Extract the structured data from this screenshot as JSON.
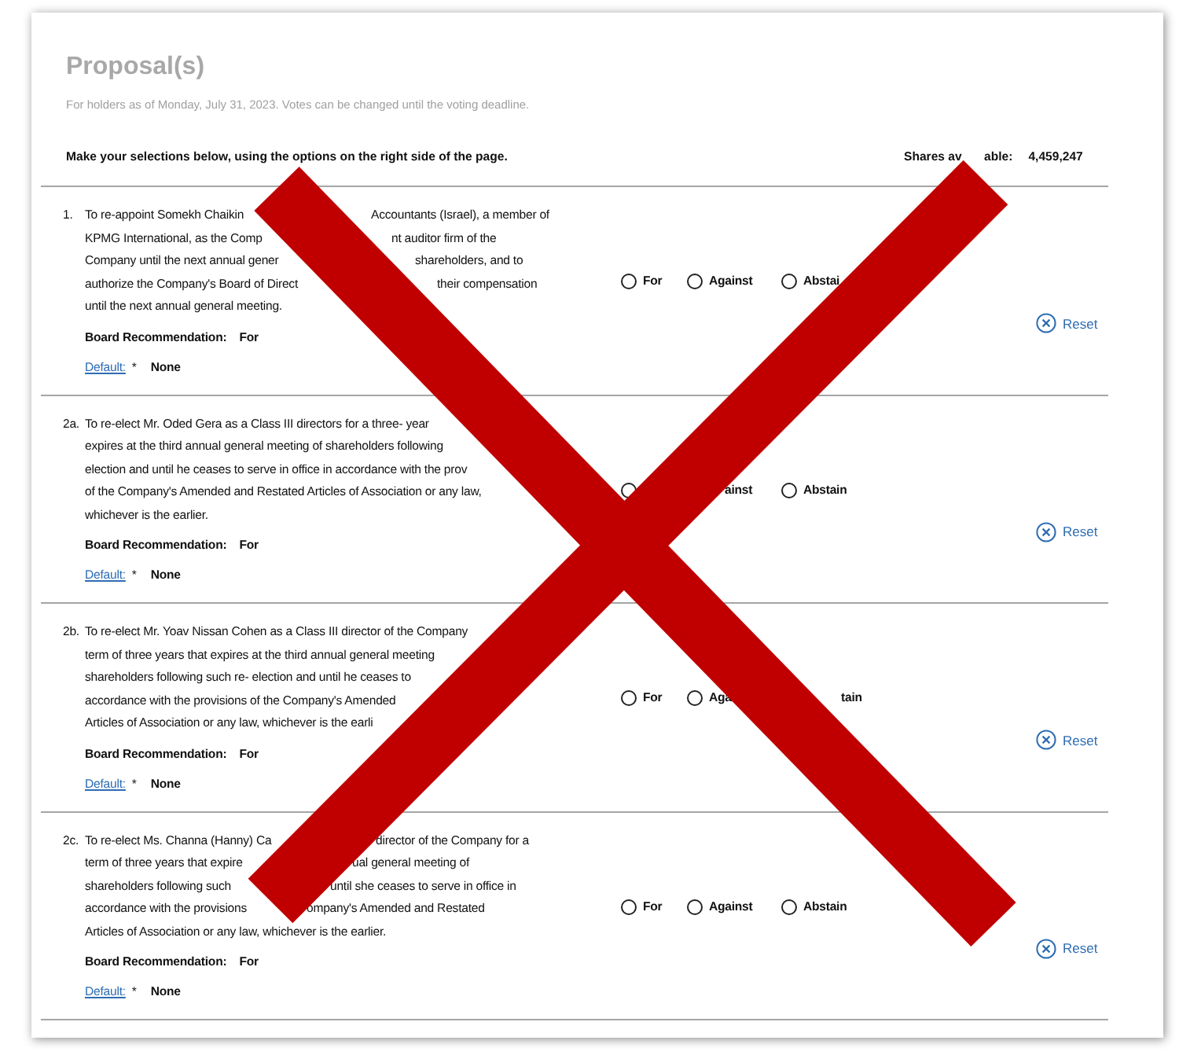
{
  "header": {
    "title": "Proposal(s)",
    "subtitle": "For holders as of Monday, July 31, 2023. Votes can be changed until the voting deadline.",
    "instructions": "Make your selections below, using the options on the right side of the page.",
    "shares_label": [
      "Shares av",
      "able:"
    ],
    "shares_value": "4,459,247"
  },
  "proposals": [
    {
      "number": "1.",
      "lines": [
        [
          "To re-appoint Somekh Chaikin",
          "Accountants (Israel), a member of"
        ],
        [
          "KPMG International, as the Comp",
          "nt auditor firm of the"
        ],
        [
          "Company until the next annual gener",
          "shareholders, and to"
        ],
        [
          "authorize the Company's Board of Direct",
          "their compensation"
        ],
        [
          "until the next annual general meeting."
        ]
      ],
      "recommendation_label": "Board Recommendation:",
      "recommendation": "For",
      "default_link": "Default:",
      "default_mark": "*",
      "default_value": "None",
      "options": [
        {
          "label": "For",
          "selected": false
        },
        {
          "label": "Against",
          "selected": false
        },
        {
          "label": "Abstai",
          "selected": false
        }
      ],
      "reset": "Reset"
    },
    {
      "number": "2a.",
      "lines": [
        [
          "To re-elect Mr. Oded Gera as a Class III directors for a three- year"
        ],
        [
          "expires at the third annual general meeting of shareholders following"
        ],
        [
          "election and until he ceases to serve in office in accordance with the prov"
        ],
        [
          "of the Company's Amended and Restated Articles of Association or any law,"
        ],
        [
          "whichever is the earlier."
        ]
      ],
      "recommendation_label": "Board Recommendation:",
      "recommendation": "For",
      "default_link": "Default:",
      "default_mark": "*",
      "default_value": "None",
      "options": [
        {
          "selected": false
        },
        {
          "label": "ainst"
        },
        {
          "label": "Abstain",
          "selected": false
        }
      ],
      "reset": "Reset"
    },
    {
      "number": "2b.",
      "lines": [
        [
          "To re-elect Mr. Yoav Nissan Cohen as a Class III director of the Company"
        ],
        [
          "term of three years that expires at the third annual general meeting"
        ],
        [
          "shareholders following such re- election and until he ceases to"
        ],
        [
          "accordance with the provisions of the Company's Amended"
        ],
        [
          "Articles of Association or any law, whichever is the earli"
        ]
      ],
      "recommendation_label": "Board Recommendation:",
      "recommendation": "For",
      "default_link": "Default:",
      "default_mark": "*",
      "default_value": "None",
      "options": [
        {
          "label": "For",
          "selected": false
        },
        {
          "label": "Aga",
          "selected": false
        },
        {
          "label": "tain"
        }
      ],
      "reset": "Reset"
    },
    {
      "number": "2c.",
      "lines": [
        [
          "To re-elect Ms. Channa (Hanny) Ca",
          "director of the Company for a"
        ],
        [
          "term of three years that expire",
          "ual general meeting of"
        ],
        [
          "shareholders following such",
          "until she ceases to serve in office in"
        ],
        [
          "accordance with the provisions",
          "ompany's Amended and Restated"
        ],
        [
          "Articles of Association or any law, whichever is the earlier."
        ]
      ],
      "recommendation_label": "Board Recommendation:",
      "recommendation": "For",
      "default_link": "Default:",
      "default_mark": "*",
      "default_value": "None",
      "options": [
        {
          "label": "For",
          "selected": false
        },
        {
          "label": "Against",
          "selected": false
        },
        {
          "label": "Abstain",
          "selected": false
        }
      ],
      "reset": "Reset"
    }
  ],
  "overlay": {
    "kind": "cross"
  }
}
